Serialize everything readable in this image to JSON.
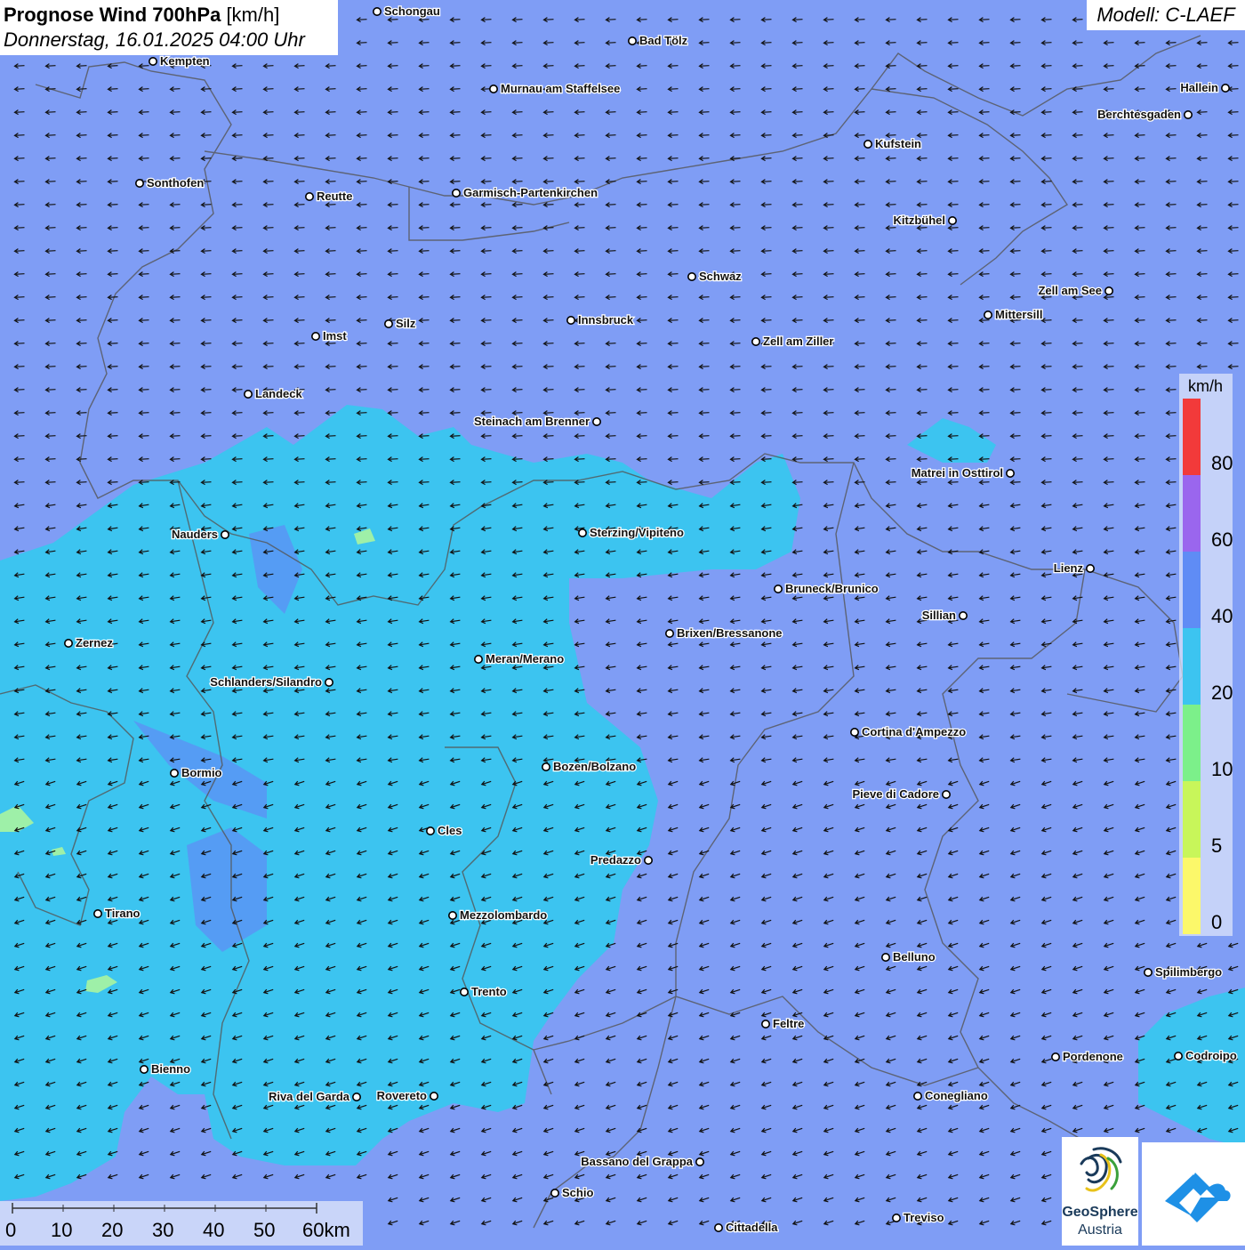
{
  "header": {
    "title_bold": "Prognose Wind 700hPa",
    "title_unit": "[km/h]",
    "datetime": "Donnerstag, 16.01.2025 04:00 Uhr",
    "model": "Modell: C-LAEF"
  },
  "legend": {
    "unit": "km/h",
    "labels": [
      "80",
      "60",
      "40",
      "20",
      "10",
      "5",
      "0"
    ],
    "colors": [
      "#f23a3a",
      "#9a66ee",
      "#5f8cf5",
      "#3cc4f0",
      "#7cf08a",
      "#c8f65a",
      "#fcf86a"
    ]
  },
  "scale": {
    "labels": [
      "0",
      "10",
      "20",
      "30",
      "40",
      "50",
      "60km"
    ]
  },
  "branding": {
    "name": "GeoSphere",
    "country": "Austria"
  },
  "colors": {
    "wind_low": "#3cc4f0",
    "wind_mid": "#7f9df5",
    "wind_calm": "#9ef0a8"
  },
  "cities": [
    {
      "name": "Schongau"
    },
    {
      "name": "Bad Tölz"
    },
    {
      "name": "Kempten"
    },
    {
      "name": "Murnau am Staffelsee"
    },
    {
      "name": "Hallein"
    },
    {
      "name": "Berchtesgaden"
    },
    {
      "name": "Kufstein"
    },
    {
      "name": "Sonthofen"
    },
    {
      "name": "Reutte"
    },
    {
      "name": "Garmisch-Partenkirchen"
    },
    {
      "name": "Kitzbühel"
    },
    {
      "name": "Schwaz"
    },
    {
      "name": "Zell am See"
    },
    {
      "name": "Mittersill"
    },
    {
      "name": "Innsbruck"
    },
    {
      "name": "Silz"
    },
    {
      "name": "Imst"
    },
    {
      "name": "Zell am Ziller"
    },
    {
      "name": "Landeck"
    },
    {
      "name": "Steinach am Brenner"
    },
    {
      "name": "Matrei in Osttirol"
    },
    {
      "name": "Nauders"
    },
    {
      "name": "Sterzing/Vipiteno"
    },
    {
      "name": "Lienz"
    },
    {
      "name": "Bruneck/Brunico"
    },
    {
      "name": "Sillian"
    },
    {
      "name": "Zernez"
    },
    {
      "name": "Brixen/Bressanone"
    },
    {
      "name": "Meran/Merano"
    },
    {
      "name": "Schlanders/Silandro"
    },
    {
      "name": "Cortina d'Ampezzo"
    },
    {
      "name": "Bozen/Bolzano"
    },
    {
      "name": "Bormio"
    },
    {
      "name": "Pieve di Cadore"
    },
    {
      "name": "Cles"
    },
    {
      "name": "Predazzo"
    },
    {
      "name": "Tirano"
    },
    {
      "name": "Mezzolombardo"
    },
    {
      "name": "Belluno"
    },
    {
      "name": "Spilimbergo"
    },
    {
      "name": "Trento"
    },
    {
      "name": "Feltre"
    },
    {
      "name": "Pordenone"
    },
    {
      "name": "Codroipo"
    },
    {
      "name": "Bienno"
    },
    {
      "name": "Riva del Garda"
    },
    {
      "name": "Rovereto"
    },
    {
      "name": "Conegliano"
    },
    {
      "name": "Bassano del Grappa"
    },
    {
      "name": "Schio"
    },
    {
      "name": "Treviso"
    },
    {
      "name": "Cittadella"
    }
  ]
}
